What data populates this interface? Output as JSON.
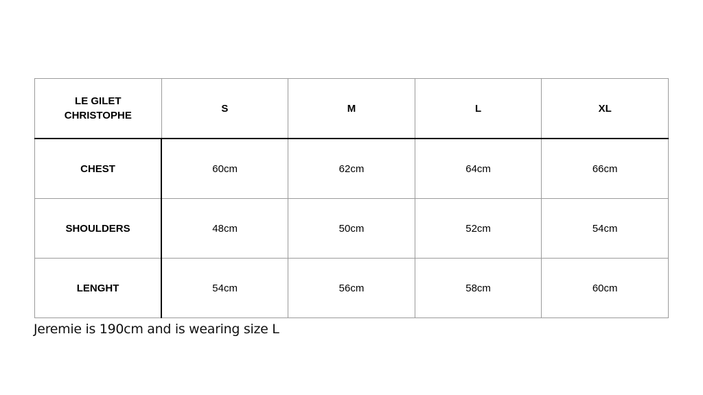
{
  "table": {
    "title_line1": "LE GILET",
    "title_line2": "CHRISTOPHE",
    "sizes": [
      "S",
      "M",
      "L",
      "XL"
    ],
    "rows": [
      {
        "label": "CHEST",
        "values": [
          "60cm",
          "62cm",
          "64cm",
          "66cm"
        ]
      },
      {
        "label": "SHOULDERS",
        "values": [
          "48cm",
          "50cm",
          "52cm",
          "54cm"
        ]
      },
      {
        "label": "LENGHT",
        "values": [
          "54cm",
          "56cm",
          "58cm",
          "60cm"
        ]
      }
    ]
  },
  "note": "Jeremie is 190cm and is wearing size L"
}
